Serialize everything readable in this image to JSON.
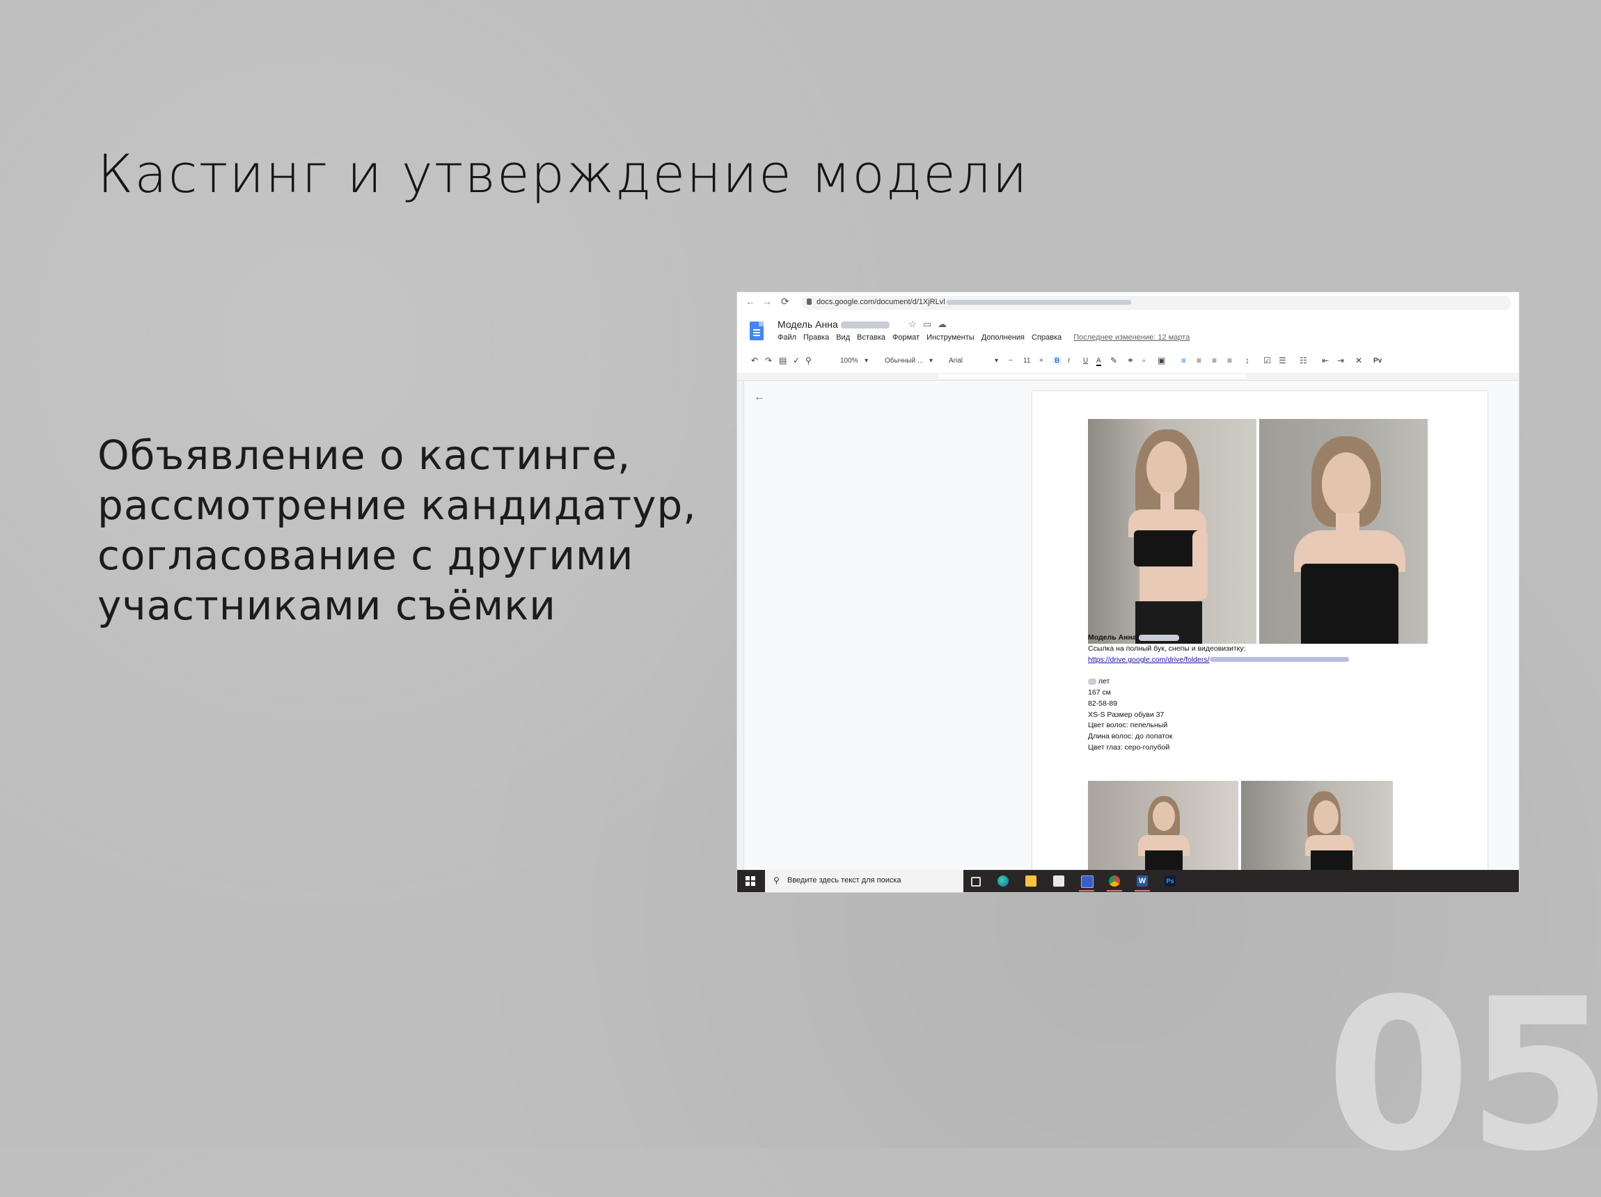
{
  "slide": {
    "title": "Кастинг и утверждение модели",
    "body_lines": [
      "Объявление о кастинге,",
      "рассмотрение кандидатур,",
      "согласование с другими",
      "участниками съёмки"
    ],
    "page_number": "05"
  },
  "browser": {
    "back": "←",
    "forward": "→",
    "reload": "⟳",
    "url": "docs.google.com/document/d/1XjRLvl"
  },
  "doc": {
    "title": "Модель Анна",
    "header_icons": [
      "star-icon",
      "folder-icon",
      "cloud-icon"
    ],
    "menu": [
      "Файл",
      "Правка",
      "Вид",
      "Вставка",
      "Формат",
      "Инструменты",
      "Дополнения",
      "Справка"
    ],
    "last_edit": "Последнее изменение: 12 марта",
    "toolbar": {
      "zoom": "100%",
      "style": "Обычный ...",
      "font": "Arial",
      "font_size": "11",
      "minus": "−",
      "plus": "+",
      "bold": "B",
      "italic": "I",
      "underline": "U",
      "text_color": "A",
      "input_tools": "Рv"
    },
    "back_arrow": "←",
    "content": {
      "model_name": "Модель Анна",
      "link_label": "Ссылка на полный бук, снепы и видеовизитку:",
      "link_url": "https://drive.google.com/drive/folders/",
      "age_suffix": "лет",
      "height": "167 см",
      "measurements": "82-58-89",
      "size_shoe": "XS-S Размер обуви 37",
      "hair_color": "Цвет волос: пепельный",
      "hair_length": "Длина волос: до лопаток",
      "eye_color": "Цвет глаз: серо-голубой"
    }
  },
  "taskbar": {
    "search_placeholder": "Введите здесь текст для поиска",
    "apps": [
      "task-view-icon",
      "edge-icon",
      "explorer-icon",
      "store-icon",
      "save-icon",
      "chrome-icon",
      "word-icon",
      "photoshop-icon"
    ],
    "word_label": "W",
    "ps_label": "Ps"
  }
}
